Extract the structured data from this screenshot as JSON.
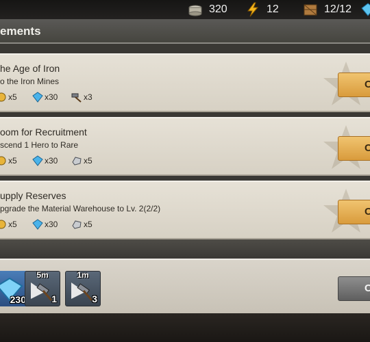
{
  "resources": [
    {
      "icon": "food-pot-icon",
      "value": "320"
    },
    {
      "icon": "energy-bolt-icon",
      "value": "12"
    },
    {
      "icon": "crate-icon",
      "value": "12/12"
    },
    {
      "icon": "gem-icon",
      "value": ""
    }
  ],
  "header": {
    "title": "ements"
  },
  "achievements": [
    {
      "title": "he Age of Iron",
      "desc": "o the Iron Mines",
      "rewards": [
        {
          "icon": "gold-coin-icon",
          "count": "x5"
        },
        {
          "icon": "blue-gem-icon",
          "count": "x30"
        },
        {
          "icon": "speedup-hammer-icon",
          "count": "x3"
        }
      ],
      "button": "C"
    },
    {
      "title": "oom for Recruitment",
      "desc": "scend 1 Hero to Rare",
      "rewards": [
        {
          "icon": "gold-coin-icon",
          "count": "x5"
        },
        {
          "icon": "blue-gem-icon",
          "count": "x30"
        },
        {
          "icon": "iron-ore-icon",
          "count": "x5"
        }
      ],
      "button": "C"
    },
    {
      "title": "upply Reserves",
      "desc": "pgrade the Material Warehouse to Lv. 2(2/2)",
      "rewards": [
        {
          "icon": "gold-coin-icon",
          "count": "x5"
        },
        {
          "icon": "blue-gem-icon",
          "count": "x30"
        },
        {
          "icon": "iron-ore-icon",
          "count": "x5"
        }
      ],
      "button": "C"
    }
  ],
  "bottom": {
    "items": [
      {
        "icon": "blue-gem-icon",
        "timer": "",
        "count": "230"
      },
      {
        "icon": "speedup-hammer-icon",
        "timer": "5m",
        "count": "1"
      },
      {
        "icon": "speedup-hammer-icon",
        "timer": "1m",
        "count": "3"
      }
    ],
    "button": "C"
  }
}
